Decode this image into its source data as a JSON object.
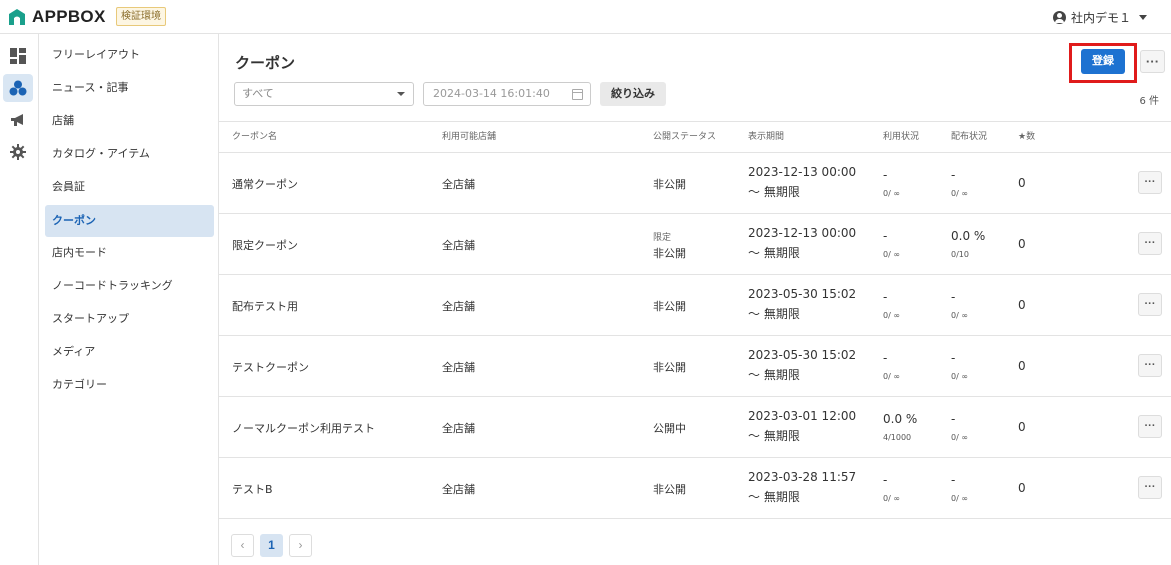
{
  "app": {
    "name": "APPBOX",
    "env_badge": "検証環境"
  },
  "user": {
    "name": "社内デモ１"
  },
  "rail": [
    {
      "icon": "dashboard-icon"
    },
    {
      "icon": "apps-icon",
      "active": true
    },
    {
      "icon": "megaphone-icon"
    },
    {
      "icon": "gear-icon"
    }
  ],
  "sidebar": {
    "items": [
      {
        "label": "フリーレイアウト"
      },
      {
        "label": "ニュース・記事"
      },
      {
        "label": "店舗"
      },
      {
        "label": "カタログ・アイテム"
      },
      {
        "label": "会員証"
      },
      {
        "label": "クーポン",
        "active": true
      },
      {
        "label": "店内モード"
      },
      {
        "label": "ノーコードトラッキング"
      },
      {
        "label": "スタートアップ"
      },
      {
        "label": "メディア"
      },
      {
        "label": "カテゴリー"
      }
    ]
  },
  "page": {
    "title": "クーポン",
    "register_label": "登録",
    "more_label": "···",
    "count_label": "6 件"
  },
  "filters": {
    "select_value": "すべて",
    "date_placeholder": "2024-03-14 16:01:40",
    "apply_label": "絞り込み"
  },
  "table": {
    "headers": {
      "name": "クーポン名",
      "store": "利用可能店舗",
      "status": "公開ステータス",
      "period": "表示期間",
      "usage": "利用状況",
      "distribution": "配布状況",
      "stars": "★数"
    },
    "rows": [
      {
        "name": "通常クーポン",
        "store": "全店舗",
        "status_sub": "",
        "status": "非公開",
        "period_start": "2023-12-13 00:00",
        "period_end": "～ 無期限",
        "usage": "-",
        "usage_sub": "0/ ∞",
        "dist": "-",
        "dist_sub": "0/ ∞",
        "stars": "0"
      },
      {
        "name": "限定クーポン",
        "store": "全店舗",
        "status_sub": "限定",
        "status": "非公開",
        "period_start": "2023-12-13 00:00",
        "period_end": "～ 無期限",
        "usage": "-",
        "usage_sub": "0/ ∞",
        "dist": "0.0 %",
        "dist_sub": "0/10",
        "stars": "0"
      },
      {
        "name": "配布テスト用",
        "store": "全店舗",
        "status_sub": "",
        "status": "非公開",
        "period_start": "2023-05-30 15:02",
        "period_end": "～ 無期限",
        "usage": "-",
        "usage_sub": "0/ ∞",
        "dist": "-",
        "dist_sub": "0/ ∞",
        "stars": "0"
      },
      {
        "name": "テストクーポン",
        "store": "全店舗",
        "status_sub": "",
        "status": "非公開",
        "period_start": "2023-05-30 15:02",
        "period_end": "～ 無期限",
        "usage": "-",
        "usage_sub": "0/ ∞",
        "dist": "-",
        "dist_sub": "0/ ∞",
        "stars": "0"
      },
      {
        "name": "ノーマルクーポン利用テスト",
        "store": "全店舗",
        "status_sub": "",
        "status": "公開中",
        "period_start": "2023-03-01 12:00",
        "period_end": "～ 無期限",
        "usage": "0.0 %",
        "usage_sub": "4/1000",
        "dist": "-",
        "dist_sub": "0/ ∞",
        "stars": "0"
      },
      {
        "name": "テストB",
        "store": "全店舗",
        "status_sub": "",
        "status": "非公開",
        "period_start": "2023-03-28 11:57",
        "period_end": "～ 無期限",
        "usage": "-",
        "usage_sub": "0/ ∞",
        "dist": "-",
        "dist_sub": "0/ ∞",
        "stars": "0"
      }
    ],
    "row_more_label": "···"
  },
  "pagination": {
    "prev": "‹",
    "current": "1",
    "next": "›"
  },
  "colors": {
    "primary": "#1d72d1",
    "highlight": "#e01b1b",
    "active_bg": "#d7e4f2",
    "logo": "#1aa08c"
  }
}
